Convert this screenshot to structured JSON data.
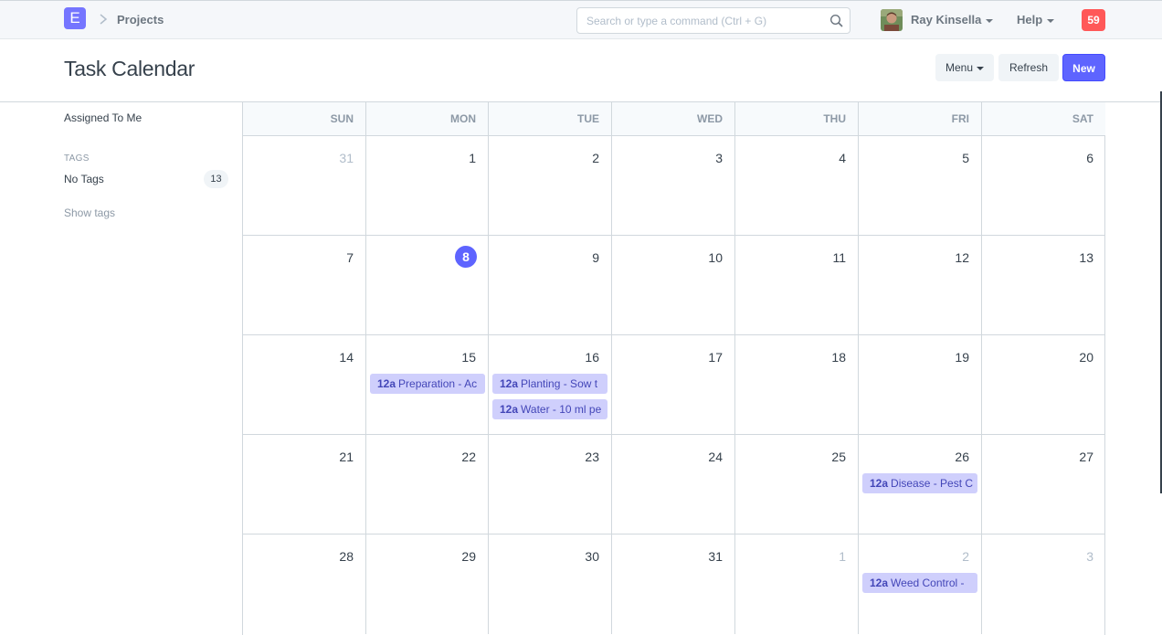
{
  "navbar": {
    "logo": "E",
    "breadcrumb": "Projects",
    "search_placeholder": "Search or type a command (Ctrl + G)",
    "user_name": "Ray Kinsella",
    "help_label": "Help",
    "notification_count": "59",
    "accent_color": "#7575ff",
    "notification_color": "#ff5858"
  },
  "page": {
    "title": "Task Calendar",
    "menu_label": "Menu",
    "refresh_label": "Refresh",
    "new_label": "New",
    "primary_color": "#5e64ff"
  },
  "sidebar": {
    "assigned_to_me": "Assigned To Me",
    "tags_heading": "TAGS",
    "no_tags_label": "No Tags",
    "no_tags_count": "13",
    "show_tags": "Show tags"
  },
  "calendar": {
    "weekdays": [
      "SUN",
      "MON",
      "TUE",
      "WED",
      "THU",
      "FRI",
      "SAT"
    ],
    "weeks": [
      [
        {
          "day": "31",
          "other": true,
          "today": false,
          "events": []
        },
        {
          "day": "1",
          "other": false,
          "today": false,
          "events": []
        },
        {
          "day": "2",
          "other": false,
          "today": false,
          "events": []
        },
        {
          "day": "3",
          "other": false,
          "today": false,
          "events": []
        },
        {
          "day": "4",
          "other": false,
          "today": false,
          "events": []
        },
        {
          "day": "5",
          "other": false,
          "today": false,
          "events": []
        },
        {
          "day": "6",
          "other": false,
          "today": false,
          "events": []
        }
      ],
      [
        {
          "day": "7",
          "other": false,
          "today": false,
          "events": []
        },
        {
          "day": "8",
          "other": false,
          "today": true,
          "events": []
        },
        {
          "day": "9",
          "other": false,
          "today": false,
          "events": []
        },
        {
          "day": "10",
          "other": false,
          "today": false,
          "events": []
        },
        {
          "day": "11",
          "other": false,
          "today": false,
          "events": []
        },
        {
          "day": "12",
          "other": false,
          "today": false,
          "events": []
        },
        {
          "day": "13",
          "other": false,
          "today": false,
          "events": []
        }
      ],
      [
        {
          "day": "14",
          "other": false,
          "today": false,
          "events": []
        },
        {
          "day": "15",
          "other": false,
          "today": false,
          "events": [
            {
              "time": "12a",
              "title": "Preparation - Ac"
            }
          ]
        },
        {
          "day": "16",
          "other": false,
          "today": false,
          "events": [
            {
              "time": "12a",
              "title": "Planting - Sow t"
            },
            {
              "time": "12a",
              "title": "Water - 10 ml pe"
            }
          ]
        },
        {
          "day": "17",
          "other": false,
          "today": false,
          "events": []
        },
        {
          "day": "18",
          "other": false,
          "today": false,
          "events": []
        },
        {
          "day": "19",
          "other": false,
          "today": false,
          "events": []
        },
        {
          "day": "20",
          "other": false,
          "today": false,
          "events": []
        }
      ],
      [
        {
          "day": "21",
          "other": false,
          "today": false,
          "events": []
        },
        {
          "day": "22",
          "other": false,
          "today": false,
          "events": []
        },
        {
          "day": "23",
          "other": false,
          "today": false,
          "events": []
        },
        {
          "day": "24",
          "other": false,
          "today": false,
          "events": []
        },
        {
          "day": "25",
          "other": false,
          "today": false,
          "events": []
        },
        {
          "day": "26",
          "other": false,
          "today": false,
          "events": [
            {
              "time": "12a",
              "title": "Disease - Pest C"
            }
          ]
        },
        {
          "day": "27",
          "other": false,
          "today": false,
          "events": []
        }
      ],
      [
        {
          "day": "28",
          "other": false,
          "today": false,
          "events": []
        },
        {
          "day": "29",
          "other": false,
          "today": false,
          "events": []
        },
        {
          "day": "30",
          "other": false,
          "today": false,
          "events": []
        },
        {
          "day": "31",
          "other": false,
          "today": false,
          "events": []
        },
        {
          "day": "1",
          "other": true,
          "today": false,
          "events": []
        },
        {
          "day": "2",
          "other": true,
          "today": false,
          "events": [
            {
              "time": "12a",
              "title": "Weed Control -"
            }
          ]
        },
        {
          "day": "3",
          "other": true,
          "today": false,
          "events": []
        }
      ]
    ]
  }
}
